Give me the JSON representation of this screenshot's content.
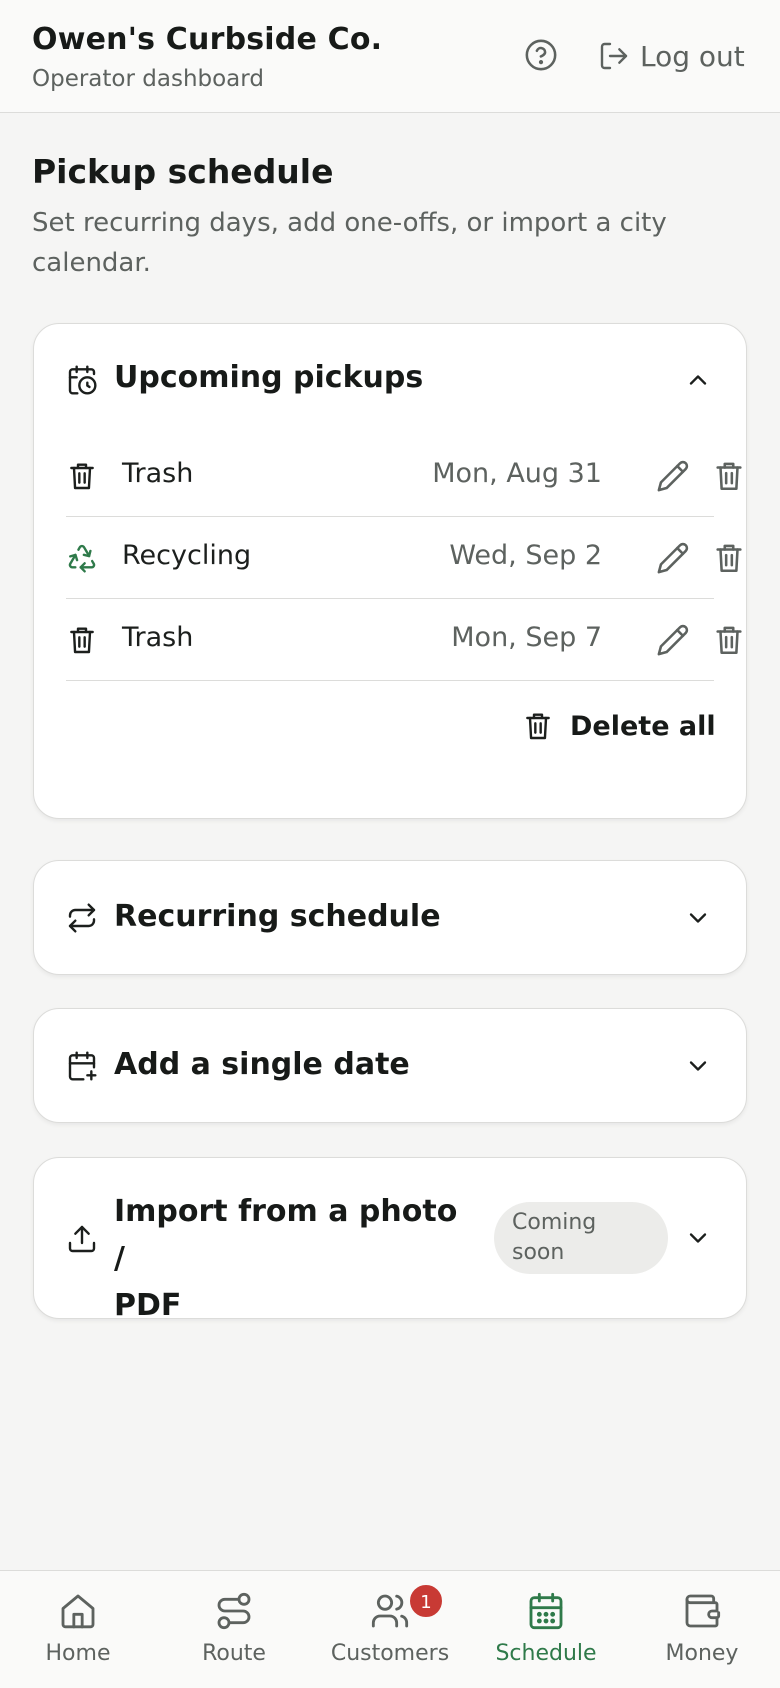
{
  "header": {
    "title": "Owen's Curbside Co.",
    "subtitle": "Operator dashboard",
    "help_icon": "question-circle-icon",
    "logout_label": "Log out"
  },
  "page": {
    "title": "Pickup schedule",
    "description": "Set recurring days, add one-offs, or import a city calendar."
  },
  "upcoming": {
    "title": "Upcoming pickups",
    "expanded": true,
    "items": [
      {
        "type": "Trash",
        "date": "Mon, Aug 31",
        "icon": "trash-bin-icon"
      },
      {
        "type": "Recycling",
        "date": "Wed, Sep 2",
        "icon": "recycle-icon"
      },
      {
        "type": "Trash",
        "date": "Mon, Sep 7",
        "icon": "trash-bin-icon"
      }
    ],
    "delete_all_label": "Delete all"
  },
  "recurring": {
    "title": "Recurring schedule",
    "expanded": false
  },
  "single_date": {
    "title": "Add a single date",
    "expanded": false
  },
  "import": {
    "title": "Import from a photo / PDF",
    "title_line1": "Import from a photo /",
    "title_line2": "PDF",
    "badge": "Coming soon",
    "expanded": false
  },
  "nav": {
    "items": [
      {
        "label": "Home",
        "icon": "home-icon",
        "active": false
      },
      {
        "label": "Route",
        "icon": "route-icon",
        "active": false
      },
      {
        "label": "Customers",
        "icon": "users-icon",
        "active": false,
        "badge": "1"
      },
      {
        "label": "Schedule",
        "icon": "calendar-icon",
        "active": true
      },
      {
        "label": "Money",
        "icon": "wallet-icon",
        "active": false
      }
    ]
  },
  "colors": {
    "accent": "#2f7a4a",
    "badge_red": "#c83a34",
    "text_muted": "#5d625f",
    "background": "#f5f5f4"
  }
}
